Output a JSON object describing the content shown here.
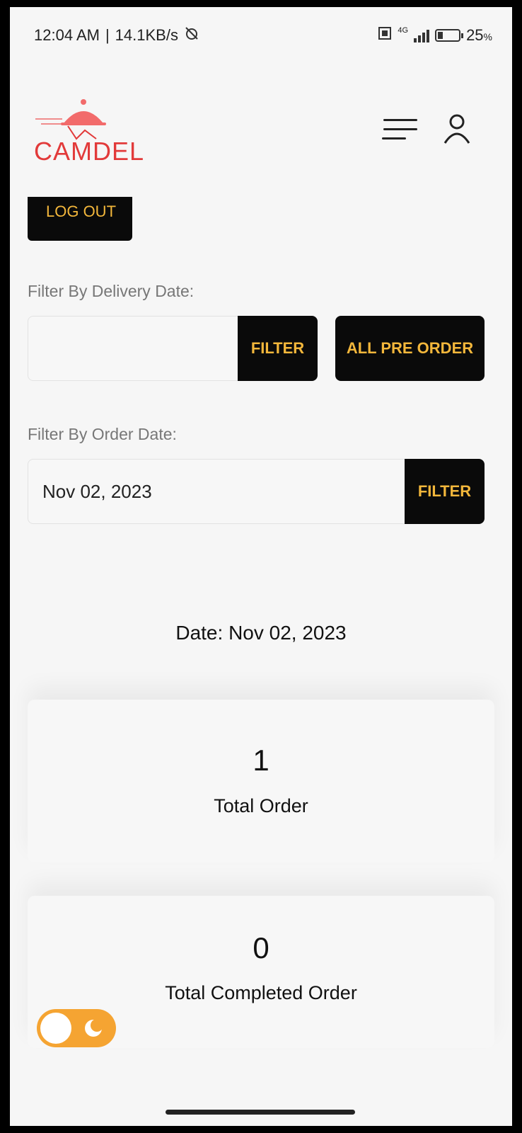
{
  "status_bar": {
    "time": "12:04 AM",
    "speed": "14.1KB/s",
    "network": "4G",
    "battery": "25",
    "battery_unit": "%",
    "battery_level": 0.25
  },
  "header": {
    "logo_text": "CAMDEL",
    "logo_color": "#e23a3a"
  },
  "logout_label": "LOG OUT",
  "delivery_filter": {
    "label": "Filter By Delivery Date:",
    "value": "",
    "filter_label": "FILTER",
    "all_pre_order_label": "ALL PRE ORDER"
  },
  "order_filter": {
    "label": "Filter By Order Date:",
    "value": "Nov 02, 2023",
    "filter_label": "FILTER"
  },
  "date_heading": "Date: Nov 02, 2023",
  "stats": [
    {
      "value": "1",
      "label": "Total Order"
    },
    {
      "value": "0",
      "label": "Total Completed Order"
    }
  ],
  "colors": {
    "accent": "#f3b73b",
    "toggle": "#f5a432",
    "button_bg": "#0a0a0a"
  }
}
